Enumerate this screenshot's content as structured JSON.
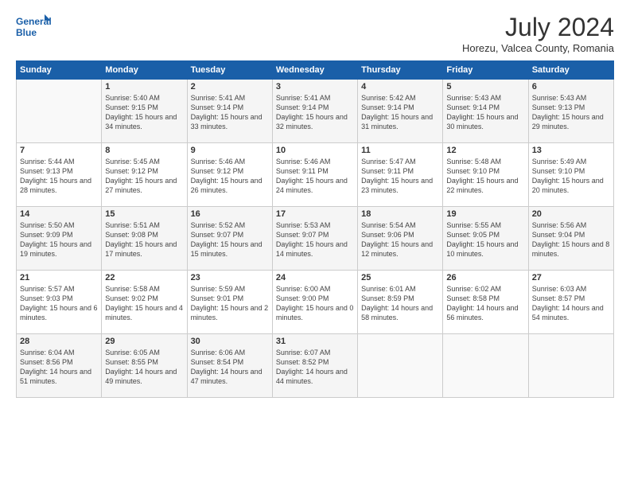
{
  "logo": {
    "line1": "General",
    "line2": "Blue"
  },
  "title": "July 2024",
  "subtitle": "Horezu, Valcea County, Romania",
  "headers": [
    "Sunday",
    "Monday",
    "Tuesday",
    "Wednesday",
    "Thursday",
    "Friday",
    "Saturday"
  ],
  "weeks": [
    [
      {
        "day": "",
        "sunrise": "",
        "sunset": "",
        "daylight": ""
      },
      {
        "day": "1",
        "sunrise": "Sunrise: 5:40 AM",
        "sunset": "Sunset: 9:15 PM",
        "daylight": "Daylight: 15 hours and 34 minutes."
      },
      {
        "day": "2",
        "sunrise": "Sunrise: 5:41 AM",
        "sunset": "Sunset: 9:14 PM",
        "daylight": "Daylight: 15 hours and 33 minutes."
      },
      {
        "day": "3",
        "sunrise": "Sunrise: 5:41 AM",
        "sunset": "Sunset: 9:14 PM",
        "daylight": "Daylight: 15 hours and 32 minutes."
      },
      {
        "day": "4",
        "sunrise": "Sunrise: 5:42 AM",
        "sunset": "Sunset: 9:14 PM",
        "daylight": "Daylight: 15 hours and 31 minutes."
      },
      {
        "day": "5",
        "sunrise": "Sunrise: 5:43 AM",
        "sunset": "Sunset: 9:14 PM",
        "daylight": "Daylight: 15 hours and 30 minutes."
      },
      {
        "day": "6",
        "sunrise": "Sunrise: 5:43 AM",
        "sunset": "Sunset: 9:13 PM",
        "daylight": "Daylight: 15 hours and 29 minutes."
      }
    ],
    [
      {
        "day": "7",
        "sunrise": "Sunrise: 5:44 AM",
        "sunset": "Sunset: 9:13 PM",
        "daylight": "Daylight: 15 hours and 28 minutes."
      },
      {
        "day": "8",
        "sunrise": "Sunrise: 5:45 AM",
        "sunset": "Sunset: 9:12 PM",
        "daylight": "Daylight: 15 hours and 27 minutes."
      },
      {
        "day": "9",
        "sunrise": "Sunrise: 5:46 AM",
        "sunset": "Sunset: 9:12 PM",
        "daylight": "Daylight: 15 hours and 26 minutes."
      },
      {
        "day": "10",
        "sunrise": "Sunrise: 5:46 AM",
        "sunset": "Sunset: 9:11 PM",
        "daylight": "Daylight: 15 hours and 24 minutes."
      },
      {
        "day": "11",
        "sunrise": "Sunrise: 5:47 AM",
        "sunset": "Sunset: 9:11 PM",
        "daylight": "Daylight: 15 hours and 23 minutes."
      },
      {
        "day": "12",
        "sunrise": "Sunrise: 5:48 AM",
        "sunset": "Sunset: 9:10 PM",
        "daylight": "Daylight: 15 hours and 22 minutes."
      },
      {
        "day": "13",
        "sunrise": "Sunrise: 5:49 AM",
        "sunset": "Sunset: 9:10 PM",
        "daylight": "Daylight: 15 hours and 20 minutes."
      }
    ],
    [
      {
        "day": "14",
        "sunrise": "Sunrise: 5:50 AM",
        "sunset": "Sunset: 9:09 PM",
        "daylight": "Daylight: 15 hours and 19 minutes."
      },
      {
        "day": "15",
        "sunrise": "Sunrise: 5:51 AM",
        "sunset": "Sunset: 9:08 PM",
        "daylight": "Daylight: 15 hours and 17 minutes."
      },
      {
        "day": "16",
        "sunrise": "Sunrise: 5:52 AM",
        "sunset": "Sunset: 9:07 PM",
        "daylight": "Daylight: 15 hours and 15 minutes."
      },
      {
        "day": "17",
        "sunrise": "Sunrise: 5:53 AM",
        "sunset": "Sunset: 9:07 PM",
        "daylight": "Daylight: 15 hours and 14 minutes."
      },
      {
        "day": "18",
        "sunrise": "Sunrise: 5:54 AM",
        "sunset": "Sunset: 9:06 PM",
        "daylight": "Daylight: 15 hours and 12 minutes."
      },
      {
        "day": "19",
        "sunrise": "Sunrise: 5:55 AM",
        "sunset": "Sunset: 9:05 PM",
        "daylight": "Daylight: 15 hours and 10 minutes."
      },
      {
        "day": "20",
        "sunrise": "Sunrise: 5:56 AM",
        "sunset": "Sunset: 9:04 PM",
        "daylight": "Daylight: 15 hours and 8 minutes."
      }
    ],
    [
      {
        "day": "21",
        "sunrise": "Sunrise: 5:57 AM",
        "sunset": "Sunset: 9:03 PM",
        "daylight": "Daylight: 15 hours and 6 minutes."
      },
      {
        "day": "22",
        "sunrise": "Sunrise: 5:58 AM",
        "sunset": "Sunset: 9:02 PM",
        "daylight": "Daylight: 15 hours and 4 minutes."
      },
      {
        "day": "23",
        "sunrise": "Sunrise: 5:59 AM",
        "sunset": "Sunset: 9:01 PM",
        "daylight": "Daylight: 15 hours and 2 minutes."
      },
      {
        "day": "24",
        "sunrise": "Sunrise: 6:00 AM",
        "sunset": "Sunset: 9:00 PM",
        "daylight": "Daylight: 15 hours and 0 minutes."
      },
      {
        "day": "25",
        "sunrise": "Sunrise: 6:01 AM",
        "sunset": "Sunset: 8:59 PM",
        "daylight": "Daylight: 14 hours and 58 minutes."
      },
      {
        "day": "26",
        "sunrise": "Sunrise: 6:02 AM",
        "sunset": "Sunset: 8:58 PM",
        "daylight": "Daylight: 14 hours and 56 minutes."
      },
      {
        "day": "27",
        "sunrise": "Sunrise: 6:03 AM",
        "sunset": "Sunset: 8:57 PM",
        "daylight": "Daylight: 14 hours and 54 minutes."
      }
    ],
    [
      {
        "day": "28",
        "sunrise": "Sunrise: 6:04 AM",
        "sunset": "Sunset: 8:56 PM",
        "daylight": "Daylight: 14 hours and 51 minutes."
      },
      {
        "day": "29",
        "sunrise": "Sunrise: 6:05 AM",
        "sunset": "Sunset: 8:55 PM",
        "daylight": "Daylight: 14 hours and 49 minutes."
      },
      {
        "day": "30",
        "sunrise": "Sunrise: 6:06 AM",
        "sunset": "Sunset: 8:54 PM",
        "daylight": "Daylight: 14 hours and 47 minutes."
      },
      {
        "day": "31",
        "sunrise": "Sunrise: 6:07 AM",
        "sunset": "Sunset: 8:52 PM",
        "daylight": "Daylight: 14 hours and 44 minutes."
      },
      {
        "day": "",
        "sunrise": "",
        "sunset": "",
        "daylight": ""
      },
      {
        "day": "",
        "sunrise": "",
        "sunset": "",
        "daylight": ""
      },
      {
        "day": "",
        "sunrise": "",
        "sunset": "",
        "daylight": ""
      }
    ]
  ]
}
